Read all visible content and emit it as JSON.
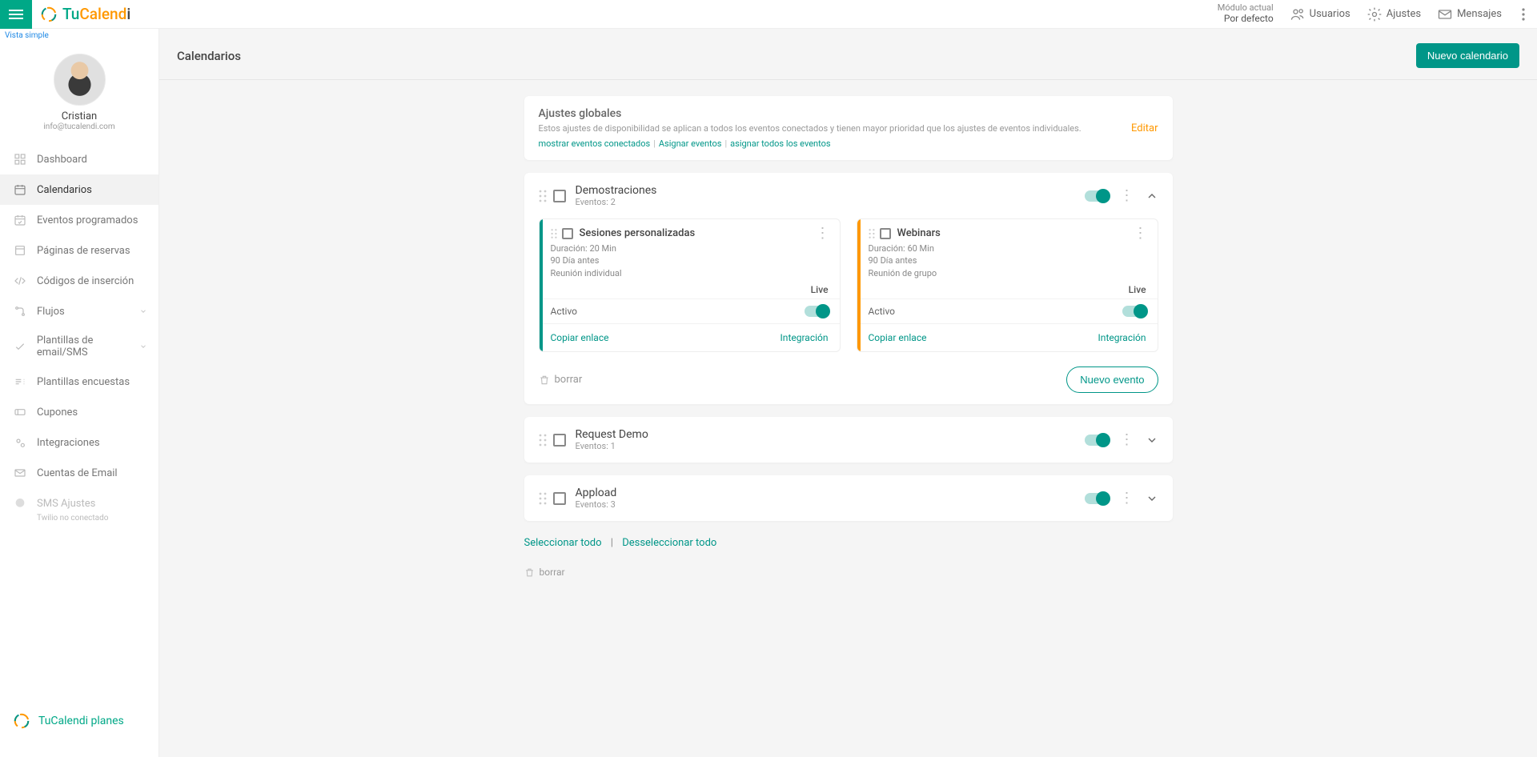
{
  "brand": {
    "tu": "Tu",
    "calend": "Calend",
    "i": "i"
  },
  "header": {
    "module_label": "Módulo actual",
    "module_value": "Por defecto",
    "users": "Usuarios",
    "settings": "Ajustes",
    "messages": "Mensajes"
  },
  "sidebar": {
    "vista": "Vista simple",
    "user_name": "Cristian",
    "user_email": "info@tucalendi.com",
    "items": {
      "dashboard": "Dashboard",
      "calendars": "Calendarios",
      "scheduled": "Eventos programados",
      "booking_pages": "Páginas de reservas",
      "embed_codes": "Códigos de inserción",
      "flows": "Flujos",
      "templates": "Plantillas de email/SMS",
      "surveys": "Plantillas encuestas",
      "coupons": "Cupones",
      "integrations": "Integraciones",
      "email_accounts": "Cuentas de Email",
      "sms_settings": "SMS Ajustes",
      "sms_sub": "Twilio no conectado"
    },
    "footer": "TuCalendi planes"
  },
  "page": {
    "title": "Calendarios",
    "new_calendar": "Nuevo calendario"
  },
  "global": {
    "title": "Ajustes globales",
    "desc": "Estos ajustes de disponibilidad se aplican a todos los eventos conectados y tienen mayor prioridad que los ajustes de eventos individuales.",
    "link1": "mostrar eventos conectados",
    "link2": "Asignar eventos",
    "link3": "asignar todos los eventos",
    "edit": "Editar"
  },
  "calendars": [
    {
      "name": "Demostraciones",
      "events_label": "Eventos: 2",
      "expanded": true,
      "events": [
        {
          "title": "Sesiones personalizadas",
          "duration": "Duración: 20 Min",
          "lead": "90 Día antes",
          "type": "Reunión individual",
          "live": "Live",
          "active": "Activo",
          "copy": "Copiar enlace",
          "integration": "Integración"
        },
        {
          "title": "Webinars",
          "duration": "Duración: 60 Min",
          "lead": "90 Día antes",
          "type": "Reunión de grupo",
          "live": "Live",
          "active": "Activo",
          "copy": "Copiar enlace",
          "integration": "Integración"
        }
      ],
      "delete": "borrar",
      "new_event": "Nuevo evento"
    },
    {
      "name": "Request Demo",
      "events_label": "Eventos: 1",
      "expanded": false
    },
    {
      "name": "Appload",
      "events_label": "Eventos: 3",
      "expanded": false
    }
  ],
  "selection": {
    "select_all": "Seleccionar todo",
    "deselect_all": "Desseleccionar todo",
    "delete": "borrar"
  }
}
